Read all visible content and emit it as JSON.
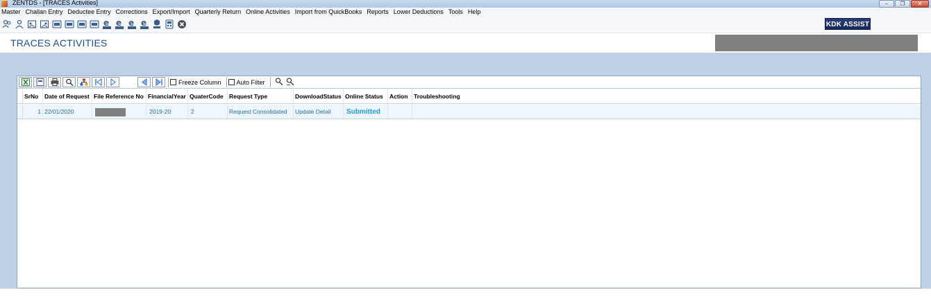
{
  "window": {
    "title": "ZENTDS - [TRACES Activities]",
    "buttons": {
      "minimize": "–",
      "restore": "❐",
      "close": "✕"
    }
  },
  "menu": [
    "Master",
    "Challan Entry",
    "Deductee Entry",
    "Corrections",
    "Export/Import",
    "Quarterly Return",
    "Online Activities",
    "Import from QuickBooks",
    "Reports",
    "Lower Deductions",
    "Tools",
    "Help"
  ],
  "toolbar": {
    "kdk_assist": "KDK ASSIST"
  },
  "page": {
    "title": "TRACES ACTIVITIES"
  },
  "grid_toolbar": {
    "freeze_column": "Freeze Column",
    "auto_filter": "Auto Filter"
  },
  "table": {
    "columns": [
      "SrNo",
      "Date of Request",
      "File Reference No",
      "FinancialYear",
      "QuaterCode",
      "Request Type",
      "DownloadStatus",
      "Online Status",
      "Action",
      "Troubleshooting"
    ],
    "rows": [
      {
        "srno": "1",
        "date": "22/01/2020",
        "file_ref": "",
        "financial_year": "2019-20",
        "quarter_code": "2",
        "request_type": "Request Consolidated",
        "download_status": "Update Detail",
        "online_status": "Submitted",
        "action": "",
        "troubleshooting": ""
      }
    ]
  },
  "colors": {
    "title_blue": "#1b4e8d",
    "link_blue": "#1f6fb0",
    "submitted": "#1e9ad6",
    "background_blue": "#bed0e6"
  }
}
